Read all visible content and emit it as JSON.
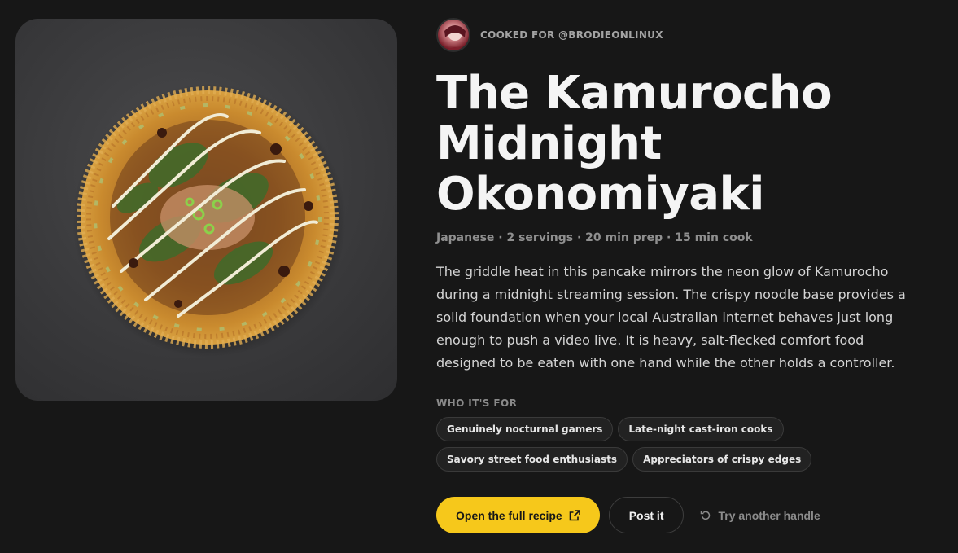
{
  "author": {
    "cooked_for_label": "COOKED FOR @BRODIEONLINUX",
    "avatar_icon": "avatar-icon"
  },
  "recipe": {
    "title": "The Kamurocho Midnight Okonomiyaki",
    "meta": "Japanese · 2 servings · 20 min prep · 15 min cook",
    "description": "The griddle heat in this pancake mirrors the neon glow of Kamurocho during a midnight streaming session. The crispy noodle base provides a solid foundation when your local Australian internet behaves just long enough to push a video live. It is heavy, salt-flecked comfort food designed to be eaten with one hand while the other holds a controller."
  },
  "audience": {
    "label": "WHO IT'S FOR",
    "chips": [
      "Genuinely nocturnal gamers",
      "Late-night cast-iron cooks",
      "Savory street food enthusiasts",
      "Appreciators of crispy edges"
    ]
  },
  "actions": {
    "open_recipe": "Open the full recipe",
    "open_recipe_icon": "external-link-icon",
    "post": "Post it",
    "retry": "Try another handle",
    "retry_icon": "refresh-icon"
  },
  "colors": {
    "background": "#171717",
    "accent": "#f6c81b",
    "chip_border": "#3a3a3a"
  }
}
